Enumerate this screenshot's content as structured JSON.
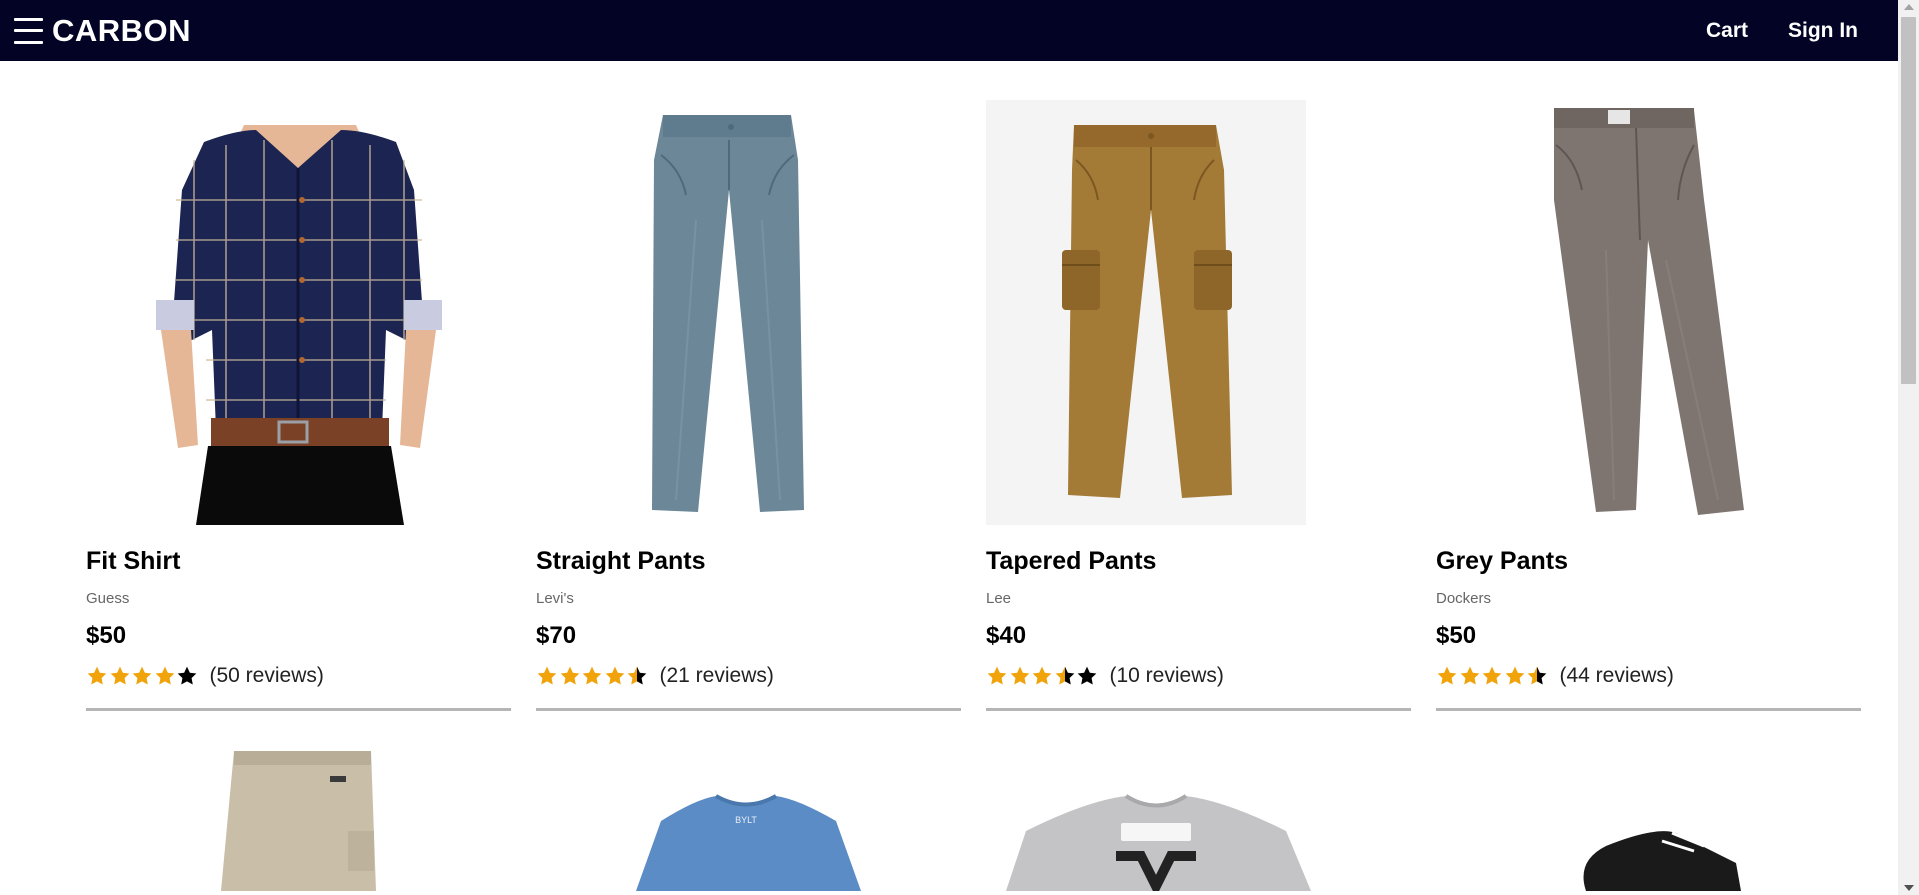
{
  "header": {
    "brand": "CARBON",
    "nav": {
      "cart": "Cart",
      "sign_in": "Sign In"
    }
  },
  "colors": {
    "header_bg": "#020325",
    "star": "#f0a30a",
    "star_empty": "#000000"
  },
  "products": [
    {
      "name": "Fit Shirt",
      "brand": "Guess",
      "price": "$50",
      "rating": 4,
      "reviews": "(50 reviews)",
      "image": "plaid-navy-shirt"
    },
    {
      "name": "Straight Pants",
      "brand": "Levi's",
      "price": "$70",
      "rating": 4.5,
      "reviews": "(21 reviews)",
      "image": "slate-blue-pants"
    },
    {
      "name": "Tapered Pants",
      "brand": "Lee",
      "price": "$40",
      "rating": 3.5,
      "reviews": "(10 reviews)",
      "image": "khaki-cargo-pants"
    },
    {
      "name": "Grey Pants",
      "brand": "Dockers",
      "price": "$50",
      "rating": 4.5,
      "reviews": "(44 reviews)",
      "image": "grey-chino-pants"
    }
  ],
  "products_row2": [
    {
      "image": "beige-shorts"
    },
    {
      "image": "blue-tshirt"
    },
    {
      "image": "grey-vans-tshirt"
    },
    {
      "image": "black-sneaker"
    }
  ]
}
